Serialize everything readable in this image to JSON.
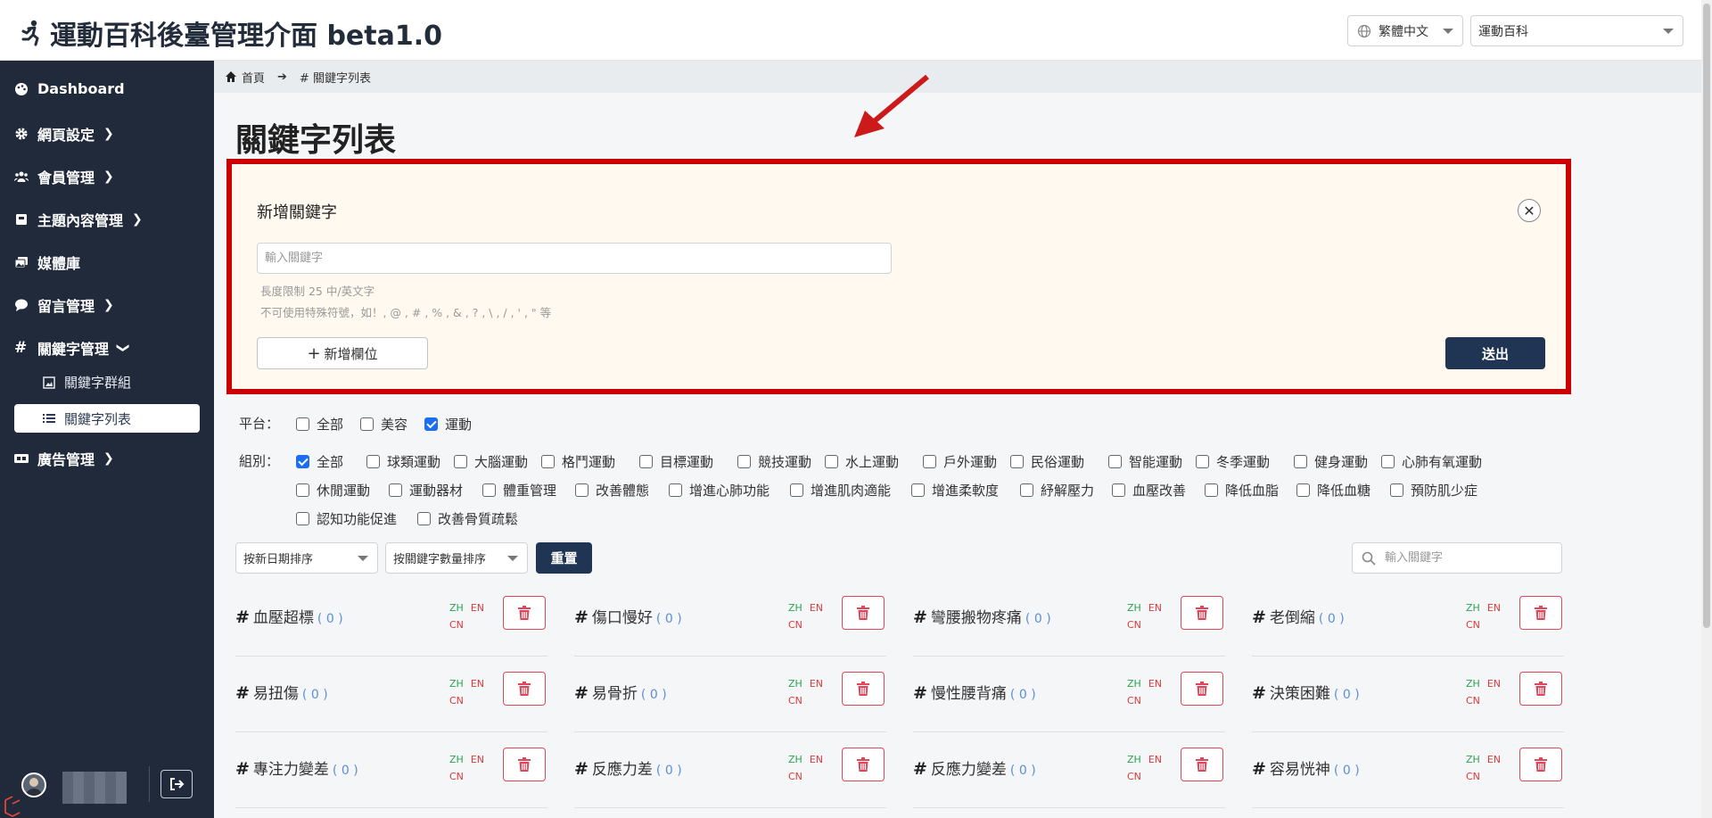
{
  "header": {
    "title": "運動百科後臺管理介面 beta1.0",
    "language": "繁體中文",
    "site": "運動百科"
  },
  "sidebar": {
    "items": [
      {
        "label": "Dashboard",
        "icon": "palette-icon"
      },
      {
        "label": "網頁設定",
        "icon": "gear-icon"
      },
      {
        "label": "會員管理",
        "icon": "users-icon"
      },
      {
        "label": "主題內容管理",
        "icon": "book-icon"
      },
      {
        "label": "媒體庫",
        "icon": "images-icon"
      },
      {
        "label": "留言管理",
        "icon": "comment-icon"
      },
      {
        "label": "關鍵字管理",
        "icon": "hash-icon"
      },
      {
        "label": "廣告管理",
        "icon": "ad-icon"
      }
    ],
    "sub_items": [
      {
        "label": "關鍵字群組",
        "icon": "image-icon"
      },
      {
        "label": "關鍵字列表",
        "icon": "list-icon"
      }
    ]
  },
  "breadcrumb": {
    "home": "首頁",
    "current": "# 關鍵字列表"
  },
  "page_title": "關鍵字列表",
  "new_keyword": {
    "title": "新增關鍵字",
    "input_placeholder": "輸入關鍵字",
    "hint_length": "長度限制 25 中/英文字",
    "hint_chars": "不可使用特殊符號，如！, @ , # , % , & , ? , \\ , / , ' , \" 等",
    "add_field": "新增欄位",
    "submit": "送出"
  },
  "filters": {
    "platform_label": "平台：",
    "platforms": [
      {
        "label": "全部",
        "checked": false
      },
      {
        "label": "美容",
        "checked": false
      },
      {
        "label": "運動",
        "checked": true
      }
    ],
    "group_label": "組別：",
    "groups_row1": [
      {
        "label": "全部",
        "checked": true
      },
      {
        "label": "球類運動",
        "checked": false
      },
      {
        "label": "大腦運動",
        "checked": false
      },
      {
        "label": "格鬥運動",
        "checked": false
      },
      {
        "label": "目標運動",
        "checked": false
      },
      {
        "label": "競技運動",
        "checked": false
      },
      {
        "label": "水上運動",
        "checked": false
      },
      {
        "label": "戶外運動",
        "checked": false
      },
      {
        "label": "民俗運動",
        "checked": false
      },
      {
        "label": "智能運動",
        "checked": false
      },
      {
        "label": "冬季運動",
        "checked": false
      },
      {
        "label": "健身運動",
        "checked": false
      },
      {
        "label": "心肺有氧運動",
        "checked": false
      }
    ],
    "groups_row2": [
      {
        "label": "休閒運動",
        "checked": false
      },
      {
        "label": "運動器材",
        "checked": false
      },
      {
        "label": "體重管理",
        "checked": false
      },
      {
        "label": "改善體態",
        "checked": false
      },
      {
        "label": "增進心肺功能",
        "checked": false
      },
      {
        "label": "增進肌肉適能",
        "checked": false
      },
      {
        "label": "增進柔軟度",
        "checked": false
      },
      {
        "label": "紓解壓力",
        "checked": false
      },
      {
        "label": "血壓改善",
        "checked": false
      },
      {
        "label": "降低血脂",
        "checked": false
      },
      {
        "label": "降低血糖",
        "checked": false
      },
      {
        "label": "預防肌少症",
        "checked": false
      }
    ],
    "groups_row3": [
      {
        "label": "認知功能促進",
        "checked": false
      },
      {
        "label": "改善骨質疏鬆",
        "checked": false
      }
    ]
  },
  "controls": {
    "sort_date": "按新日期排序",
    "sort_count": "按關鍵字數量排序",
    "reset": "重置",
    "search_placeholder": "輸入關鍵字"
  },
  "keywords": [
    {
      "name": "血壓超標",
      "count": "( 0 )"
    },
    {
      "name": "傷口慢好",
      "count": "( 0 )"
    },
    {
      "name": "彎腰搬物疼痛",
      "count": "( 0 )"
    },
    {
      "name": "老倒縮",
      "count": "( 0 )"
    },
    {
      "name": "易扭傷",
      "count": "( 0 )"
    },
    {
      "name": "易骨折",
      "count": "( 0 )"
    },
    {
      "name": "慢性腰背痛",
      "count": "( 0 )"
    },
    {
      "name": "決策困難",
      "count": "( 0 )"
    },
    {
      "name": "專注力變差",
      "count": "( 0 )"
    },
    {
      "name": "反應力差",
      "count": "( 0 )"
    },
    {
      "name": "反應力變差",
      "count": "( 0 )"
    },
    {
      "name": "容易恍神",
      "count": "( 0 )"
    }
  ],
  "lang_tags": {
    "zh": "ZH",
    "en": "EN",
    "cn": "CN"
  },
  "colors": {
    "sidebar_bg": "#202a3a",
    "primary_button": "#1f3553",
    "highlight_border": "#cc0000",
    "checkbox_checked": "#1b6ef3",
    "delete_red": "#e0465a"
  }
}
